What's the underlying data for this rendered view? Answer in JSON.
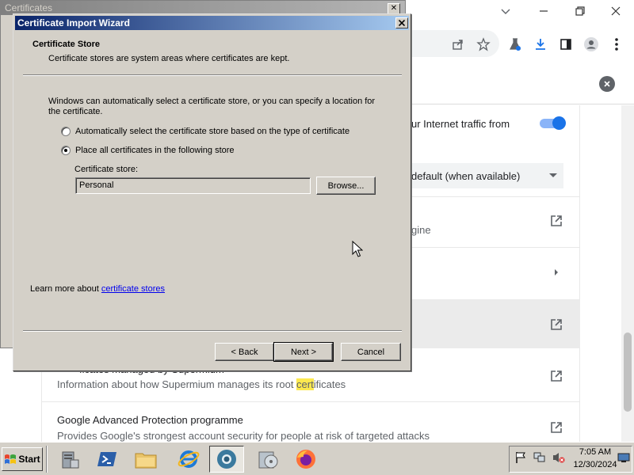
{
  "browser": {
    "background_items": [
      {
        "title": "ur Internet traffic from",
        "has_toggle": true
      },
      {
        "title": "default (when available)",
        "has_dropdown": true
      },
      {
        "title": "gine",
        "has_external_link": true
      },
      {
        "title": "",
        "has_chevron": true
      },
      {
        "title": "",
        "has_external_link": true,
        "hovered": true
      },
      {
        "title_partial": "ficates managed by Supermium",
        "subtitle_before": "Information about how Supermium manages its root ",
        "subtitle_highlight": "cert",
        "subtitle_after": "ificates",
        "has_external_link": true
      },
      {
        "title": "Google Advanced Protection programme",
        "subtitle": "Provides Google's strongest account security for people at risk of targeted attacks",
        "has_external_link": true
      }
    ],
    "toggle_on": true
  },
  "certificates_window": {
    "title": "Certificates"
  },
  "wizard": {
    "title": "Certificate Import Wizard",
    "heading": "Certificate Store",
    "subheading": "Certificate stores are system areas where certificates are kept.",
    "description": "Windows can automatically select a certificate store, or you can specify a location for the certificate.",
    "options": [
      {
        "label": "Automatically select the certificate store based on the type of certificate",
        "selected": false
      },
      {
        "label": "Place all certificates in the following store",
        "selected": true
      }
    ],
    "store_label": "Certificate store:",
    "store_value": "Personal",
    "browse_label": "Browse...",
    "learn_more_prefix": "Learn more about ",
    "learn_more_link": "certificate stores",
    "back_label": "< Back",
    "next_label": "Next >",
    "cancel_label": "Cancel"
  },
  "taskbar": {
    "start_label": "Start",
    "time": "7:05 AM",
    "date": "12/30/2024",
    "apps": [
      "server-manager-icon",
      "powershell-icon",
      "file-explorer-icon",
      "internet-explorer-icon",
      "supermium-browser-icon",
      "disc-utility-icon",
      "firefox-icon"
    ]
  },
  "colors": {
    "title_bar_active": "#0a246a",
    "dialog_face": "#d4d0c8",
    "link": "#0000ee",
    "toggle_accent": "#1a73e8",
    "highlight": "#fce94f"
  }
}
